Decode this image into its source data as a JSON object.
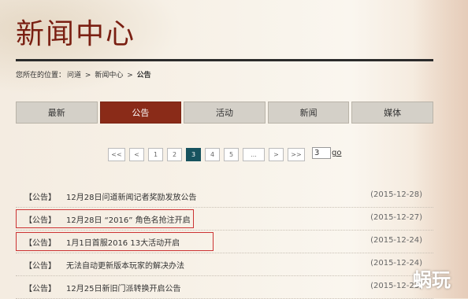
{
  "header": {
    "title": "新闻中心"
  },
  "breadcrumb": {
    "prefix": "您所在的位置：",
    "items": [
      "问道",
      "新闻中心",
      "公告"
    ],
    "separator": ">"
  },
  "tabs": [
    {
      "label": "最新",
      "active": false
    },
    {
      "label": "公告",
      "active": true
    },
    {
      "label": "活动",
      "active": false
    },
    {
      "label": "新闻",
      "active": false
    },
    {
      "label": "媒体",
      "active": false
    }
  ],
  "pagination": {
    "first": "<<",
    "prev": "<",
    "pages": [
      "1",
      "2",
      "3",
      "4",
      "5"
    ],
    "current": "3",
    "ellipsis": "...",
    "next": ">",
    "last": ">>",
    "jump_value": "3",
    "go_label": "go"
  },
  "news": [
    {
      "category": "【公告】",
      "title": "12月28日问道新闻记者奖励发放公告",
      "date": "(2015-12-28)",
      "highlighted": false
    },
    {
      "category": "【公告】",
      "title": "12月28日 “2016” 角色名抢注开启",
      "date": "(2015-12-27)",
      "highlighted": true
    },
    {
      "category": "【公告】",
      "title": "1月1日首服2016 13大活动开启",
      "date": "(2015-12-24)",
      "highlighted": true
    },
    {
      "category": "【公告】",
      "title": "无法自动更新版本玩家的解决办法",
      "date": "(2015-12-24)",
      "highlighted": false
    },
    {
      "category": "【公告】",
      "title": "12月25日新旧门派转换开启公告",
      "date": "(2015-12-23)",
      "highlighted": false
    }
  ],
  "watermark": "蜗玩",
  "colors": {
    "title": "#7a1f12",
    "active_tab": "#8a2b18",
    "active_page": "#17535f",
    "highlight_border": "#cc3333"
  }
}
